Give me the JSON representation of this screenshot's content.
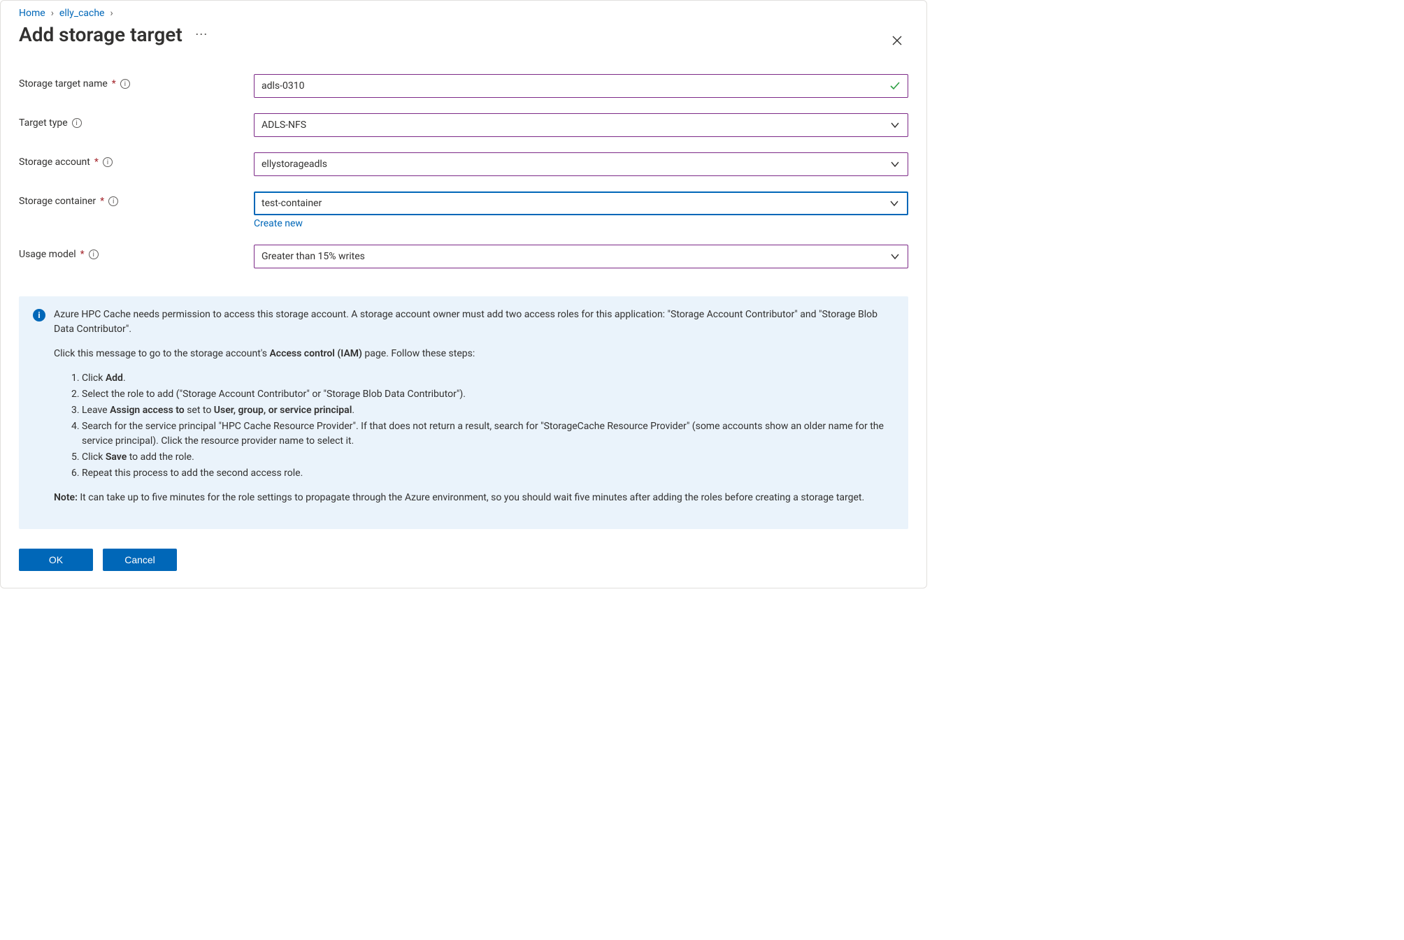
{
  "breadcrumb": {
    "home": "Home",
    "cache": "elly_cache"
  },
  "title": "Add storage target",
  "close_label": "Close",
  "more_label": "More",
  "fields": {
    "name": {
      "label": "Storage target name",
      "value": "adls-0310",
      "required": true
    },
    "target_type": {
      "label": "Target type",
      "value": "ADLS-NFS",
      "required": false
    },
    "storage_account": {
      "label": "Storage account",
      "value": "ellystorageadls",
      "required": true
    },
    "storage_container": {
      "label": "Storage container",
      "value": "test-container",
      "required": true,
      "create_new": "Create new"
    },
    "usage_model": {
      "label": "Usage model",
      "value": "Greater than 15% writes",
      "required": true
    }
  },
  "info": {
    "intro": "Azure HPC Cache needs permission to access this storage account. A storage account owner must add two access roles for this application: \"Storage Account Contributor\" and \"Storage Blob Data Contributor\".",
    "click_prefix": "Click this message to go to the storage account's ",
    "click_bold": "Access control (IAM)",
    "click_suffix": " page. Follow these steps:",
    "steps": {
      "s1_a": "Click ",
      "s1_b": "Add",
      "s1_c": ".",
      "s2": "Select the role to add (\"Storage Account Contributor\" or \"Storage Blob Data Contributor\").",
      "s3_a": "Leave ",
      "s3_b": "Assign access to",
      "s3_c": " set to ",
      "s3_d": "User, group, or service principal",
      "s3_e": ".",
      "s4": "Search for the service principal \"HPC Cache Resource Provider\". If that does not return a result, search for \"StorageCache Resource Provider\" (some accounts show an older name for the service principal). Click the resource provider name to select it.",
      "s5_a": "Click ",
      "s5_b": "Save",
      "s5_c": " to add the role.",
      "s6": "Repeat this process to add the second access role."
    },
    "note_label": "Note:",
    "note_text": " It can take up to five minutes for the role settings to propagate through the Azure environment, so you should wait five minutes after adding the roles before creating a storage target."
  },
  "buttons": {
    "ok": "OK",
    "cancel": "Cancel"
  }
}
